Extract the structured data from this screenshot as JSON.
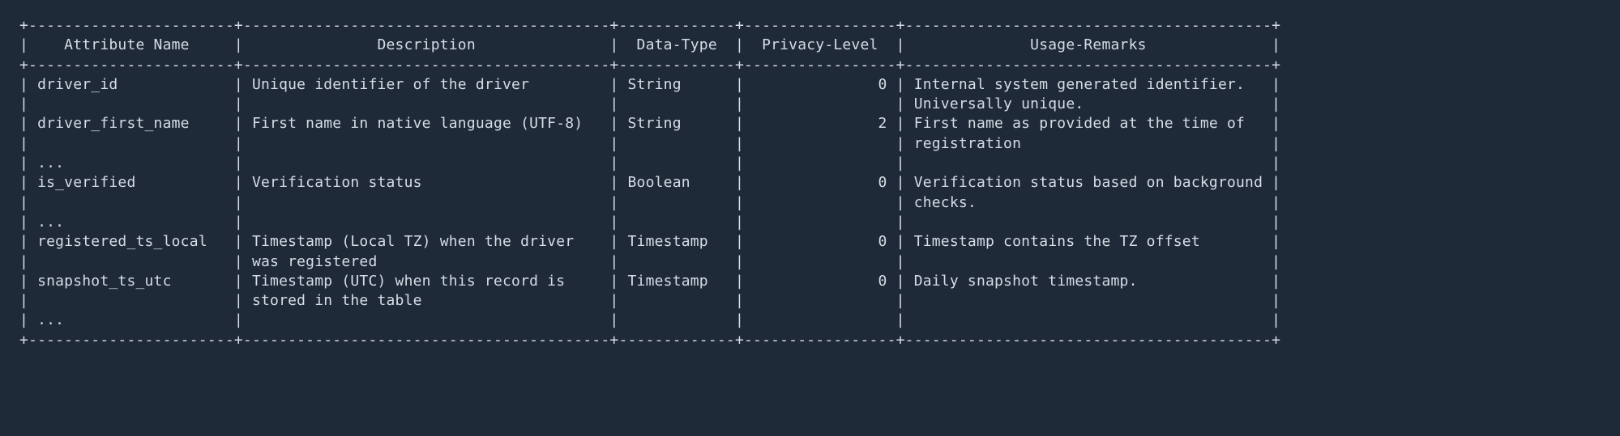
{
  "chart_data": {
    "type": "table",
    "title": "",
    "columns": [
      "Attribute Name",
      "Description",
      "Data-Type",
      "Privacy-Level",
      "Usage-Remarks"
    ],
    "rows": [
      {
        "attribute_name": "driver_id",
        "description": "Unique identifier of the driver",
        "data_type": "String",
        "privacy_level": 0,
        "usage_remarks": "Internal system generated identifier. Universally unique."
      },
      {
        "attribute_name": "driver_first_name",
        "description": "First name in native language (UTF-8)",
        "data_type": "String",
        "privacy_level": 2,
        "usage_remarks": "First name as provided at the time of registration"
      },
      {
        "attribute_name": "...",
        "description": "",
        "data_type": "",
        "privacy_level": "",
        "usage_remarks": ""
      },
      {
        "attribute_name": "is_verified",
        "description": "Verification status",
        "data_type": "Boolean",
        "privacy_level": 0,
        "usage_remarks": "Verification status based on background checks."
      },
      {
        "attribute_name": "...",
        "description": "",
        "data_type": "",
        "privacy_level": "",
        "usage_remarks": ""
      },
      {
        "attribute_name": "registered_ts_local",
        "description": "Timestamp (Local TZ) when the driver was registered",
        "data_type": "Timestamp",
        "privacy_level": 0,
        "usage_remarks": "Timestamp contains the TZ offset"
      },
      {
        "attribute_name": "snapshot_ts_utc",
        "description": "Timestamp (UTC) when this record is stored in the table",
        "data_type": "Timestamp",
        "privacy_level": 0,
        "usage_remarks": "Daily snapshot timestamp."
      },
      {
        "attribute_name": "...",
        "description": "",
        "data_type": "",
        "privacy_level": "",
        "usage_remarks": ""
      }
    ]
  },
  "layout": {
    "widths": {
      "attr": 21,
      "desc": 39,
      "dtype": 11,
      "priv": 15,
      "usage": 39
    },
    "align": {
      "attr": "left",
      "desc": "left",
      "dtype": "left",
      "priv": "right",
      "usage": "left"
    },
    "header_align": {
      "attr": "center",
      "desc": "center",
      "dtype": "center",
      "priv": "center",
      "usage": "center"
    }
  }
}
